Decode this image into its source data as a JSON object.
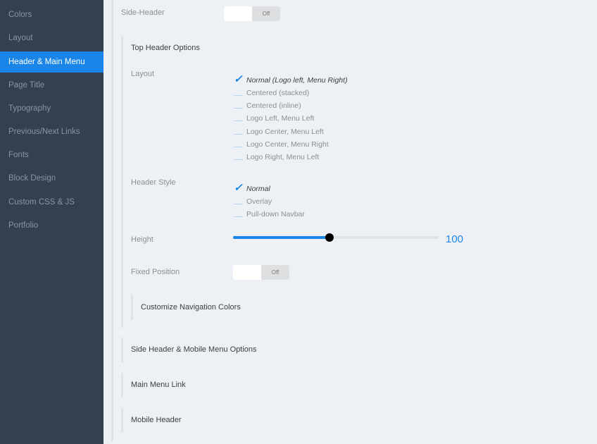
{
  "sidebar": {
    "items": [
      {
        "label": "Colors",
        "active": false
      },
      {
        "label": "Layout",
        "active": false
      },
      {
        "label": "Header & Main Menu",
        "active": true
      },
      {
        "label": "Page Title",
        "active": false
      },
      {
        "label": "Typography",
        "active": false
      },
      {
        "label": "Previous/Next Links",
        "active": false
      },
      {
        "label": "Fonts",
        "active": false
      },
      {
        "label": "Block Design",
        "active": false
      },
      {
        "label": "Custom CSS & JS",
        "active": false
      },
      {
        "label": "Portfolio",
        "active": false
      }
    ]
  },
  "main": {
    "side_header": {
      "label": "Side-Header",
      "toggle_state": "Off"
    },
    "top_header_options": {
      "title": "Top Header Options",
      "layout": {
        "label": "Layout",
        "options": [
          "Normal (Logo left, Menu Right)",
          "Centered (stacked)",
          "Centered (inline)",
          "Logo Left, Menu Left",
          "Logo Center, Menu Left",
          "Logo Center, Menu Right",
          "Logo Right, Menu Left"
        ],
        "selected": "Normal (Logo left, Menu Right)"
      },
      "header_style": {
        "label": "Header Style",
        "options": [
          "Normal",
          "Overlay",
          "Pull-down Navbar"
        ],
        "selected": "Normal"
      },
      "height": {
        "label": "Height",
        "value": "100",
        "fill_percent": 47
      },
      "fixed_position": {
        "label": "Fixed Position",
        "toggle_state": "Off"
      },
      "customize_nav_colors": {
        "title": "Customize Navigation Colors"
      }
    },
    "sections": [
      {
        "title": "Side Header & Mobile Menu Options"
      },
      {
        "title": "Main Menu Link"
      },
      {
        "title": "Mobile Header"
      }
    ]
  },
  "colors": {
    "sidebar_bg": "#343f4f",
    "accent": "#1a85e8",
    "content_bg": "#edf1f5"
  }
}
